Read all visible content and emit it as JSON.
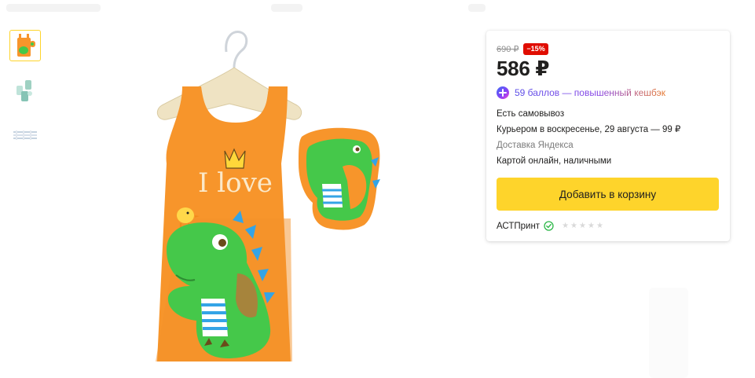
{
  "gallery": {
    "thumbnails": [
      {
        "icon": "apron-thumb-orange",
        "active": true
      },
      {
        "icon": "apron-thumb-green",
        "active": false
      },
      {
        "icon": "size-chart-thumb",
        "active": false
      }
    ],
    "main_image": {
      "icon": "orange-dinosaur-apron-with-sleeves",
      "print_text": "I love"
    }
  },
  "offer": {
    "old_price": "690 ₽",
    "discount": "−15%",
    "price": "586 ₽",
    "cashback": "59 баллов — повышенный кешбэк",
    "pickup": "Есть самовывоз",
    "courier": "Курьером в воскресенье, 29 августа — 99 ₽",
    "delivery_service": "Доставка Яндекса",
    "payment": "Картой онлайн, наличными",
    "cart_button": "Добавить в корзину",
    "seller": "АСТПринт",
    "rating_stars": 0,
    "rating_max": 5
  },
  "colors": {
    "accent_yellow": "#fed42b",
    "discount_red": "#e00d00",
    "apron_orange": "#f7952b",
    "dino_green": "#45c84a"
  }
}
